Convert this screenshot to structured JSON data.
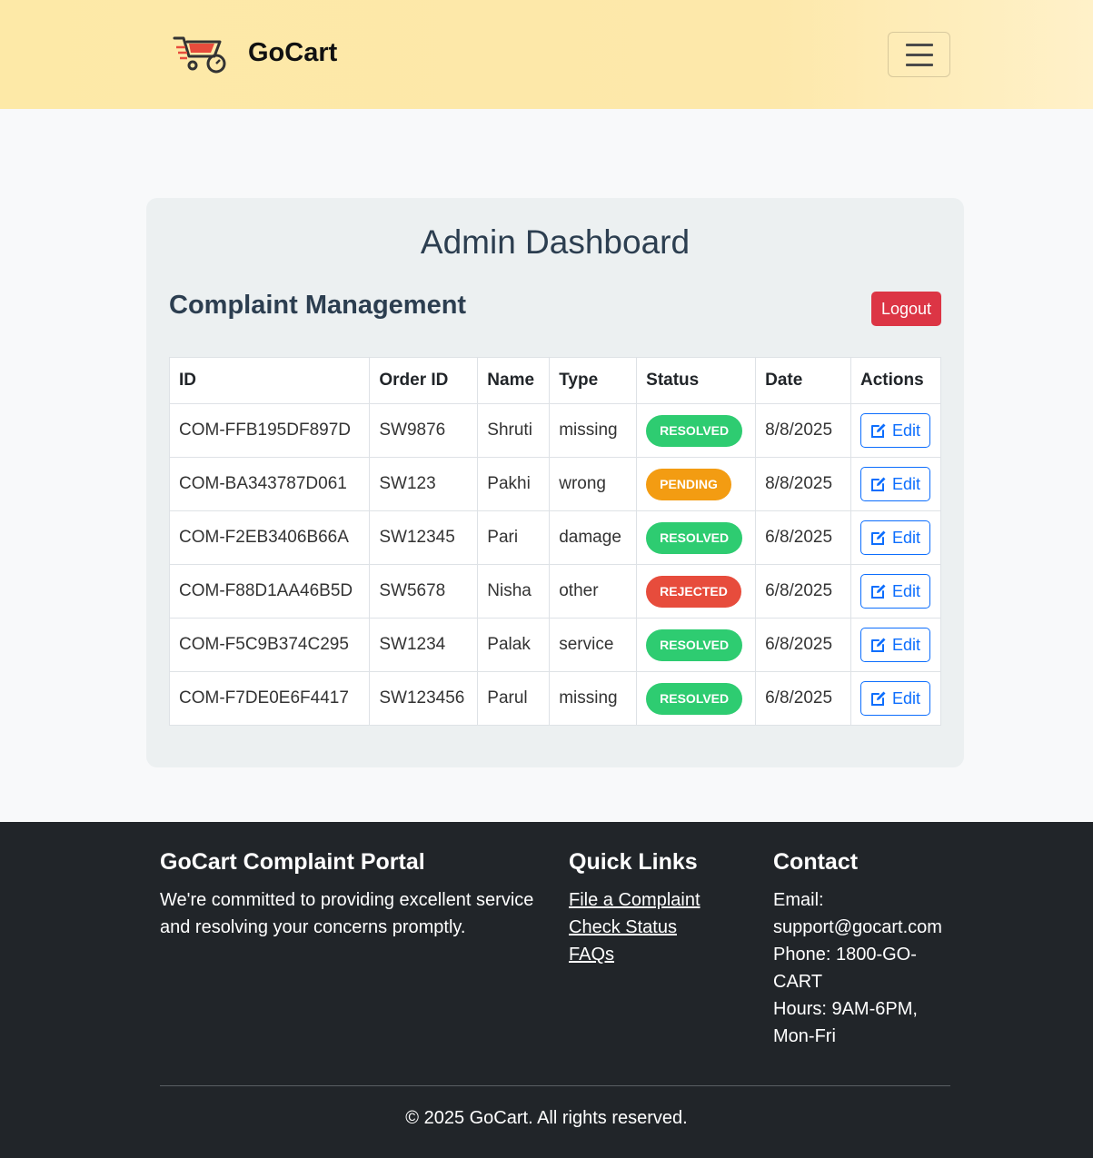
{
  "brand": {
    "name": "GoCart"
  },
  "dashboard": {
    "title": "Admin Dashboard",
    "subtitle": "Complaint Management",
    "logout_label": "Logout"
  },
  "table": {
    "headers": [
      "ID",
      "Order ID",
      "Name",
      "Type",
      "Status",
      "Date",
      "Actions"
    ],
    "rows": [
      {
        "id": "COM-FFB195DF897D",
        "order": "SW9876",
        "name": "Shruti",
        "type": "missing",
        "status": "RESOLVED",
        "date": "8/8/2025",
        "action": "Edit"
      },
      {
        "id": "COM-BA343787D061",
        "order": "SW123",
        "name": "Pakhi",
        "type": "wrong",
        "status": "PENDING",
        "date": "8/8/2025",
        "action": "Edit"
      },
      {
        "id": "COM-F2EB3406B66A",
        "order": "SW12345",
        "name": "Pari",
        "type": "damage",
        "status": "RESOLVED",
        "date": "6/8/2025",
        "action": "Edit"
      },
      {
        "id": "COM-F88D1AA46B5D",
        "order": "SW5678",
        "name": "Nisha",
        "type": "other",
        "status": "REJECTED",
        "date": "6/8/2025",
        "action": "Edit"
      },
      {
        "id": "COM-F5C9B374C295",
        "order": "SW1234",
        "name": "Palak",
        "type": "service",
        "status": "RESOLVED",
        "date": "6/8/2025",
        "action": "Edit"
      },
      {
        "id": "COM-F7DE0E6F4417",
        "order": "SW123456",
        "name": "Parul",
        "type": "missing",
        "status": "RESOLVED",
        "date": "6/8/2025",
        "action": "Edit"
      }
    ]
  },
  "status_colors": {
    "RESOLVED": "#2ecc71",
    "PENDING": "#f39c12",
    "REJECTED": "#e74c3c"
  },
  "footer": {
    "about_title": "GoCart Complaint Portal",
    "about_text": "We're committed to providing excellent service and resolving your concerns promptly.",
    "links_title": "Quick Links",
    "links": [
      "File a Complaint",
      "Check Status",
      "FAQs"
    ],
    "contact_title": "Contact",
    "contact_lines": [
      "Email: support@gocart.com",
      "Phone: 1800-GO-CART",
      "Hours: 9AM-6PM, Mon-Fri"
    ],
    "copyright": "© 2025 GoCart. All rights reserved."
  }
}
